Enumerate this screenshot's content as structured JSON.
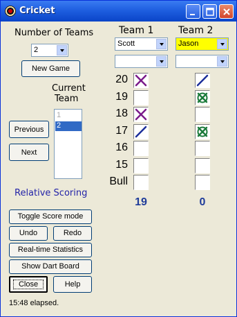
{
  "window": {
    "title": "Cricket",
    "buttons": [
      "minimize",
      "maximize",
      "close"
    ]
  },
  "left": {
    "number_of_teams_label": "Number of Teams",
    "number_of_teams_value": "2",
    "new_game_label": "New Game",
    "current_team_label_line1": "Current",
    "current_team_label_line2": "Team",
    "team_list": [
      "1",
      "2"
    ],
    "team_list_selected": "2",
    "previous_label": "Previous",
    "next_label": "Next",
    "relative_scoring_label": "Relative Scoring",
    "toggle_score_mode_label": "Toggle Score mode",
    "undo_label": "Undo",
    "redo_label": "Redo",
    "realtime_stats_label": "Real-time Statistics",
    "show_dart_board_label": "Show Dart Board",
    "close_label": "Close",
    "help_label": "Help",
    "elapsed": "15:48 elapsed."
  },
  "teams": [
    {
      "header": "Team 1",
      "player": "Scott",
      "player2": "",
      "score": "19",
      "player_bg": "#ffffff",
      "marks": [
        "x",
        "",
        "x",
        "slash",
        "",
        "",
        ""
      ]
    },
    {
      "header": "Team 2",
      "player": "Jason",
      "player2": "",
      "score": "0",
      "player_bg": "#ffff00",
      "marks": [
        "slash",
        "closed",
        "",
        "closed",
        "",
        "",
        ""
      ]
    }
  ],
  "rows": [
    "20",
    "19",
    "18",
    "17",
    "16",
    "15",
    "Bull"
  ],
  "colors": {
    "accent_blue": "#2323a8",
    "score_blue": "#1f3c9a",
    "x_purple": "#7a1a8a",
    "slash_blue": "#1c2f9a",
    "closed_green": "#1a7a3a"
  }
}
